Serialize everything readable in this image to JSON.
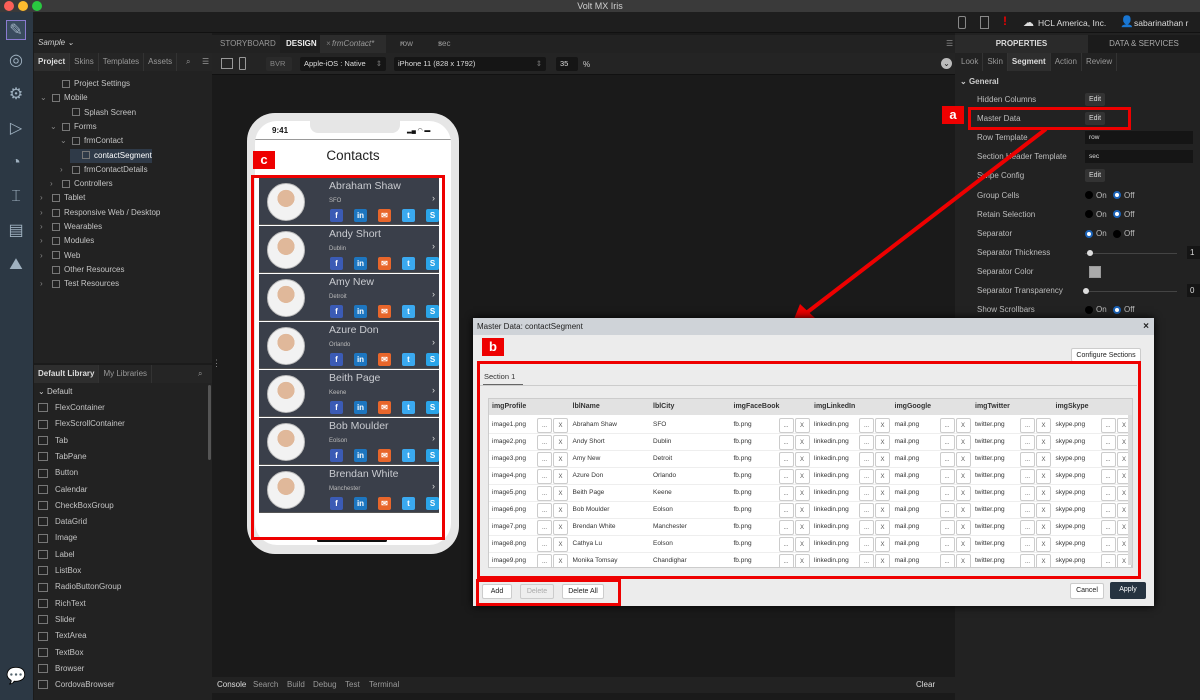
{
  "window": {
    "title": "Volt MX Iris"
  },
  "topbar": {
    "org": "HCL America, Inc.",
    "user": "sabarinathan r"
  },
  "project": {
    "name": "Sample",
    "tabs": [
      "Project",
      "Skins",
      "Templates",
      "Assets"
    ],
    "tree": [
      {
        "label": "Project Settings",
        "depth": 1,
        "arrow": ""
      },
      {
        "label": "Mobile",
        "depth": 0,
        "arrow": "⌄"
      },
      {
        "label": "Splash Screen",
        "depth": 2,
        "arrow": ""
      },
      {
        "label": "Forms",
        "depth": 1,
        "arrow": "⌄"
      },
      {
        "label": "frmContact",
        "depth": 2,
        "arrow": "⌄"
      },
      {
        "label": "contactSegment",
        "depth": 3,
        "arrow": ""
      },
      {
        "label": "frmContactDetails",
        "depth": 2,
        "arrow": "›"
      },
      {
        "label": "Controllers",
        "depth": 1,
        "arrow": "›"
      },
      {
        "label": "Tablet",
        "depth": 0,
        "arrow": "›"
      },
      {
        "label": "Responsive Web / Desktop",
        "depth": 0,
        "arrow": "›"
      },
      {
        "label": "Wearables",
        "depth": 0,
        "arrow": "›"
      },
      {
        "label": "Modules",
        "depth": 0,
        "arrow": "›"
      },
      {
        "label": "Web",
        "depth": 0,
        "arrow": "›"
      },
      {
        "label": "Other Resources",
        "depth": 0,
        "arrow": ""
      },
      {
        "label": "Test Resources",
        "depth": 0,
        "arrow": "›"
      }
    ]
  },
  "library": {
    "tabs": [
      "Default Library",
      "My Libraries"
    ],
    "group": "Default",
    "items": [
      "FlexContainer",
      "FlexScrollContainer",
      "Tab",
      "TabPane",
      "Button",
      "Calendar",
      "CheckBoxGroup",
      "DataGrid",
      "Image",
      "Label",
      "ListBox",
      "RadioButtonGroup",
      "RichText",
      "Slider",
      "TextArea",
      "TextBox",
      "Browser",
      "CordovaBrowser"
    ]
  },
  "editor": {
    "tabs": [
      "STORYBOARD",
      "DESIGN",
      "frmContact*",
      "row",
      "sec"
    ],
    "bvr": "BVR",
    "platform": "Apple-iOS : Native",
    "device": "iPhone 11 (828 x 1792)",
    "zoom": "35",
    "zoom_unit": "%"
  },
  "phone": {
    "time": "9:41",
    "title": "Contacts",
    "contacts": [
      {
        "name": "Abraham Shaw",
        "city": "SFO"
      },
      {
        "name": "Andy Short",
        "city": "Dublin"
      },
      {
        "name": "Amy New",
        "city": "Detroit"
      },
      {
        "name": "Azure Don",
        "city": "Orlando"
      },
      {
        "name": "Beith Page",
        "city": "Keene"
      },
      {
        "name": "Bob Moulder",
        "city": "Eolson"
      },
      {
        "name": "Brendan White",
        "city": "Manchester"
      }
    ],
    "social": [
      {
        "icon": "facebook-icon",
        "glyph": "f",
        "color": "#3b5bb5"
      },
      {
        "icon": "linkedin-icon",
        "glyph": "in",
        "color": "#1d76c0"
      },
      {
        "icon": "mail-icon",
        "glyph": "✉",
        "color": "#e8662b"
      },
      {
        "icon": "twitter-icon",
        "glyph": "t",
        "color": "#3aa9f0"
      },
      {
        "icon": "skype-icon",
        "glyph": "S",
        "color": "#2aa4e8"
      }
    ]
  },
  "bottom_tabs": [
    "Console",
    "Search",
    "Build",
    "Debug",
    "Test",
    "Terminal"
  ],
  "bottom_clear": "Clear",
  "properties": {
    "tabs": [
      "PROPERTIES",
      "DATA & SERVICES"
    ],
    "subtabs": [
      "Look",
      "Skin",
      "Segment",
      "Action",
      "Review"
    ],
    "section": "General",
    "rows": [
      {
        "label": "Hidden Columns",
        "type": "edit",
        "edit": "Edit"
      },
      {
        "label": "Master Data",
        "type": "edit",
        "edit": "Edit"
      },
      {
        "label": "Row Template",
        "type": "select",
        "value": "row",
        "edit": "Edit"
      },
      {
        "label": "Section Header Template",
        "type": "select",
        "value": "sec",
        "edit": "Edit"
      },
      {
        "label": "Swipe Config",
        "type": "edit",
        "edit": "Edit"
      },
      {
        "label": "Group Cells",
        "type": "radio",
        "on": "On",
        "off": "Off",
        "selected": "Off"
      },
      {
        "label": "Retain Selection",
        "type": "radio",
        "on": "On",
        "off": "Off",
        "selected": "Off"
      },
      {
        "label": "Separator",
        "type": "radio",
        "on": "On",
        "off": "Off",
        "selected": "On"
      },
      {
        "label": "Separator Thickness",
        "type": "slider",
        "value": "1",
        "unit": "P"
      },
      {
        "label": "Separator Color",
        "type": "color",
        "color": "#aaaaaa"
      },
      {
        "label": "Separator Transparency",
        "type": "slider",
        "value": "0",
        "unit": ""
      },
      {
        "label": "Show Scrollbars",
        "type": "radio",
        "on": "On",
        "off": "Off",
        "selected": "Off"
      }
    ]
  },
  "dialog": {
    "title": "Master Data: contactSegment",
    "close": "×",
    "configure": "Configure Sections",
    "section_tab": "Section 1",
    "columns": [
      "imgProfile",
      "lblName",
      "lblCity",
      "imgFaceBook",
      "imgLinkedIn",
      "imgGoogle",
      "imgTwitter",
      "imgSkype"
    ],
    "image_columns": [
      true,
      false,
      false,
      true,
      true,
      true,
      true,
      true
    ],
    "rows": [
      [
        "image1.png",
        "Abraham Shaw",
        "SFO",
        "fb.png",
        "linkedin.png",
        "mail.png",
        "twitter.png",
        "skype.png"
      ],
      [
        "image2.png",
        "Andy Short",
        "Dublin",
        "fb.png",
        "linkedin.png",
        "mail.png",
        "twitter.png",
        "skype.png"
      ],
      [
        "image3.png",
        "Amy New",
        "Detroit",
        "fb.png",
        "linkedin.png",
        "mail.png",
        "twitter.png",
        "skype.png"
      ],
      [
        "image4.png",
        "Azure Don",
        "Orlando",
        "fb.png",
        "linkedin.png",
        "mail.png",
        "twitter.png",
        "skype.png"
      ],
      [
        "image5.png",
        "Beith Page",
        "Keene",
        "fb.png",
        "linkedin.png",
        "mail.png",
        "twitter.png",
        "skype.png"
      ],
      [
        "image6.png",
        "Bob Moulder",
        "Eolson",
        "fb.png",
        "linkedin.png",
        "mail.png",
        "twitter.png",
        "skype.png"
      ],
      [
        "image7.png",
        "Brendan White",
        "Manchester",
        "fb.png",
        "linkedin.png",
        "mail.png",
        "twitter.png",
        "skype.png"
      ],
      [
        "image8.png",
        "Cathya Lu",
        "Eolson",
        "fb.png",
        "linkedin.png",
        "mail.png",
        "twitter.png",
        "skype.png"
      ],
      [
        "image9.png",
        "Monika Tomsay",
        "Chandighar",
        "fb.png",
        "linkedin.png",
        "mail.png",
        "twitter.png",
        "skype.png"
      ]
    ],
    "browse": "...",
    "clear": "X",
    "add": "Add",
    "delete": "Delete",
    "delete_all": "Delete All",
    "cancel": "Cancel",
    "apply": "Apply"
  },
  "annotations": {
    "a": "a",
    "b": "b",
    "c": "c",
    "color": "#ee0000"
  }
}
